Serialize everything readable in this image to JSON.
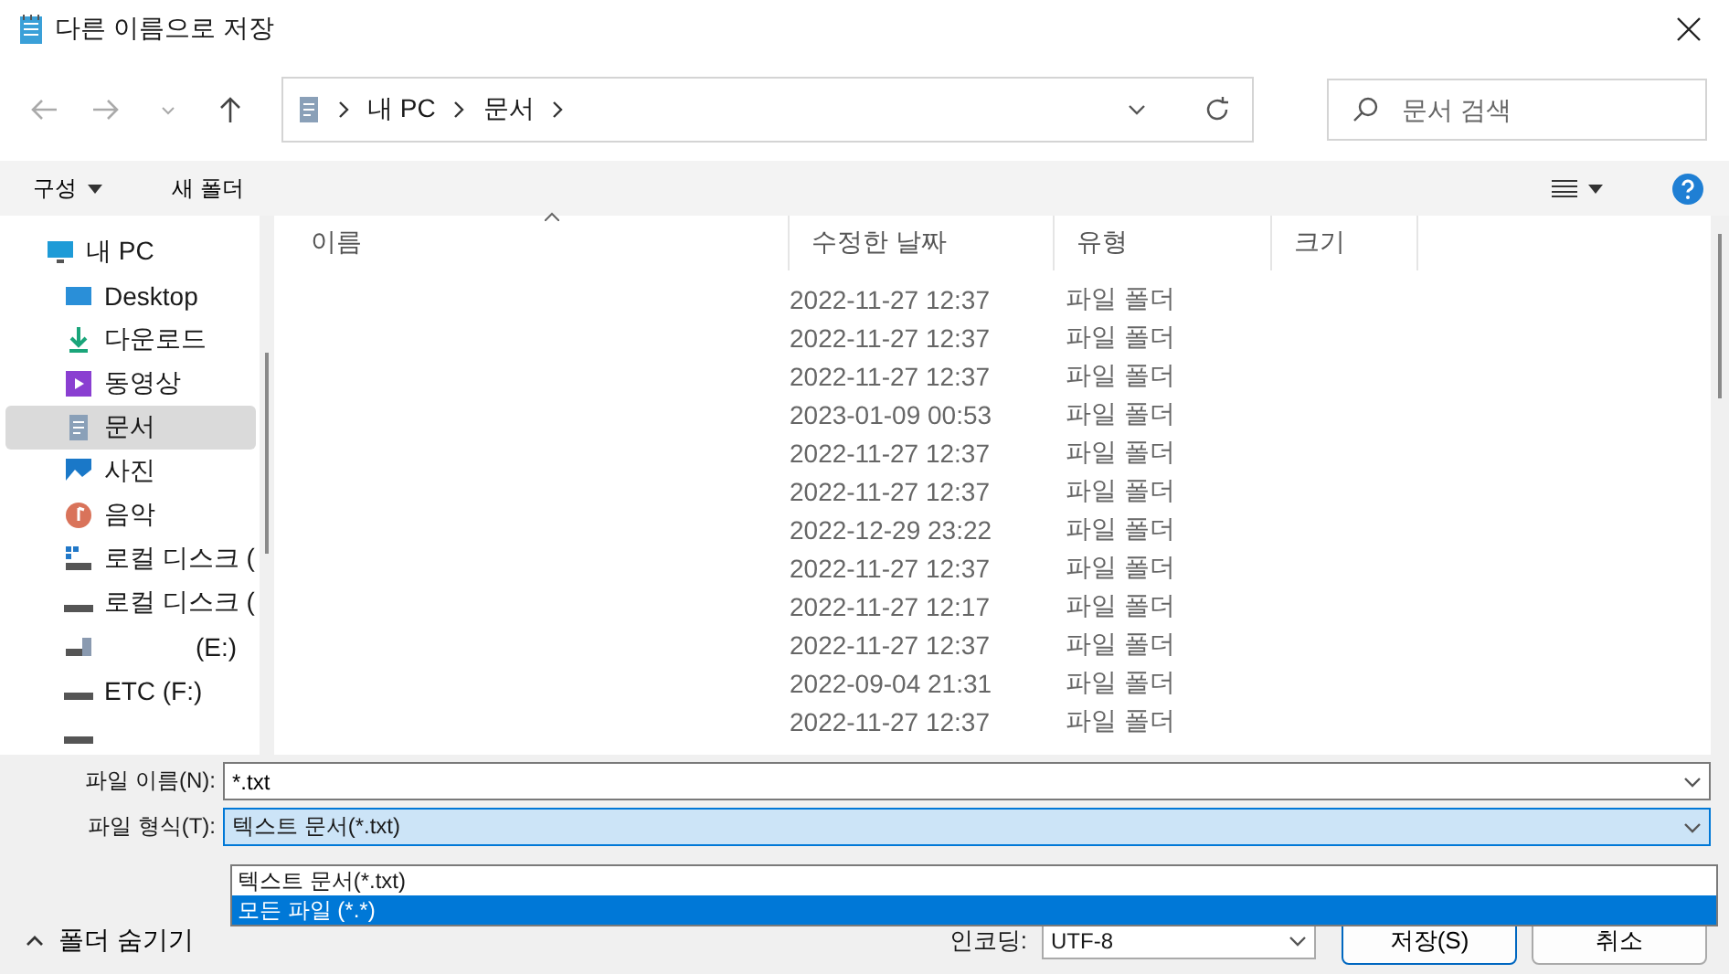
{
  "window": {
    "title": "다른 이름으로 저장"
  },
  "address": {
    "crumbs": [
      "내 PC",
      "문서"
    ],
    "search_placeholder": "문서 검색"
  },
  "toolbar": {
    "organize": "구성",
    "new_folder": "새 폴더"
  },
  "sidebar": {
    "items": [
      {
        "label": "내 PC",
        "kind": "pc",
        "selected": false,
        "children": [
          {
            "label": "Desktop",
            "kind": "desktop",
            "selected": false
          },
          {
            "label": "다운로드",
            "kind": "download",
            "selected": false
          },
          {
            "label": "동영상",
            "kind": "video",
            "selected": false
          },
          {
            "label": "문서",
            "kind": "document",
            "selected": true
          },
          {
            "label": "사진",
            "kind": "photo",
            "selected": false
          },
          {
            "label": "음악",
            "kind": "music",
            "selected": false
          },
          {
            "label": "로컬 디스크 (",
            "kind": "system-drive",
            "selected": false
          },
          {
            "label": "로컬 디스크 (",
            "kind": "drive",
            "selected": false
          },
          {
            "label": "(E:)",
            "kind": "usb",
            "selected": false
          },
          {
            "label": "ETC (F:)",
            "kind": "drive",
            "selected": false
          },
          {
            "kind": "drive",
            "selected": false
          }
        ]
      }
    ]
  },
  "table": {
    "columns": [
      "이름",
      "수정한 날짜",
      "유형",
      "크기"
    ],
    "rows": [
      {
        "date": "2022-11-27 12:37",
        "type": "파일 폴더"
      },
      {
        "date": "2022-11-27 12:37",
        "type": "파일 폴더"
      },
      {
        "date": "2022-11-27 12:37",
        "type": "파일 폴더"
      },
      {
        "date": "2023-01-09 00:53",
        "type": "파일 폴더"
      },
      {
        "date": "2022-11-27 12:37",
        "type": "파일 폴더"
      },
      {
        "date": "2022-11-27 12:37",
        "type": "파일 폴더"
      },
      {
        "date": "2022-12-29 23:22",
        "type": "파일 폴더"
      },
      {
        "date": "2022-11-27 12:37",
        "type": "파일 폴더"
      },
      {
        "date": "2022-11-27 12:17",
        "type": "파일 폴더"
      },
      {
        "date": "2022-11-27 12:37",
        "type": "파일 폴더"
      },
      {
        "date": "2022-09-04 21:31",
        "type": "파일 폴더"
      },
      {
        "date": "2022-11-27 12:37",
        "type": "파일 폴더"
      }
    ]
  },
  "form": {
    "filename_label": "파일 이름(N):",
    "filename": "*.txt",
    "filetype_label": "파일 형식(T):",
    "filetype": "텍스트 문서(*.txt)",
    "filetype_options": [
      {
        "label": "텍스트 문서(*.txt)",
        "selected": false
      },
      {
        "label": "모든 파일  (*.*)",
        "selected": true
      }
    ]
  },
  "footer": {
    "hide_folders": "폴더 숨기기",
    "encoding_label": "인코딩:",
    "encoding": "UTF-8",
    "save": "저장(S)",
    "cancel": "취소"
  }
}
